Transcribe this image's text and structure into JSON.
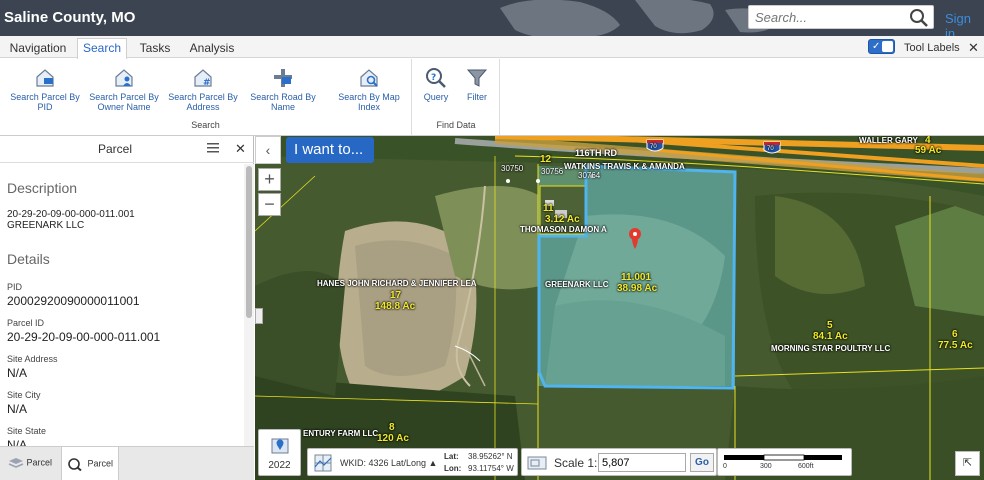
{
  "header": {
    "title": "Saline County, MO",
    "search_placeholder": "Search...",
    "sign_in": "Sign in"
  },
  "tabs": [
    {
      "label": "Navigation"
    },
    {
      "label": "Search"
    },
    {
      "label": "Tasks"
    },
    {
      "label": "Analysis"
    }
  ],
  "tool_labels": {
    "label": "Tool Labels",
    "enabled": true
  },
  "ribbon": {
    "search_group": {
      "label": "Search",
      "buttons": [
        {
          "label_line1": "Search Parcel By",
          "label_line2": "PID",
          "icon": "search-parcel-pid-icon"
        },
        {
          "label_line1": "Search Parcel By",
          "label_line2": "Owner Name",
          "icon": "search-parcel-owner-icon"
        },
        {
          "label_line1": "Search Parcel By",
          "label_line2": "Address",
          "icon": "search-parcel-address-icon"
        },
        {
          "label_line1": "Search Road By",
          "label_line2": "Name",
          "icon": "search-road-icon"
        },
        {
          "label_line1": "Search By Map",
          "label_line2": "Index",
          "icon": "search-map-index-icon"
        }
      ]
    },
    "find_group": {
      "label": "Find Data",
      "buttons": [
        {
          "label_line1": "Query",
          "icon": "query-icon"
        },
        {
          "label_line1": "Filter",
          "icon": "filter-icon"
        }
      ]
    }
  },
  "panel": {
    "title": "Parcel",
    "description_heading": "Description",
    "description_line1": "20-29-20-09-00-000-011.001",
    "description_line2": "GREENARK LLC",
    "details_heading": "Details",
    "fields": [
      {
        "label": "PID",
        "value": "20002920090000011001"
      },
      {
        "label": "Parcel ID",
        "value": "20-29-20-09-00-000-011.001"
      },
      {
        "label": "Site Address",
        "value": "N/A"
      },
      {
        "label": "Site City",
        "value": "N/A"
      },
      {
        "label": "Site State",
        "value": "N/A"
      }
    ],
    "bottom_tabs": [
      {
        "label": "Parcel",
        "icon": "layers-icon"
      },
      {
        "label": "Parcel",
        "icon": "search-results-icon"
      }
    ]
  },
  "map": {
    "i_want_to": "I want to...",
    "zoom_in": "+",
    "zoom_out": "−",
    "year": "2022",
    "wkid": "WKID: 4326 Lat/Long ▲",
    "lat_label": "Lat:",
    "lat_value": "38.95262° N",
    "lon_label": "Lon:",
    "lon_value": "93.11754° W",
    "scale_label": "Scale 1:",
    "scale_value": "5,807",
    "go": "Go",
    "scalebar_ticks": [
      "0",
      "300",
      "600ft"
    ],
    "labels": {
      "road_116th": "116TH RD",
      "i70_a": "70",
      "i70_b": "70",
      "waller": "WALLER GARY",
      "waller_num": "4",
      "waller_ac": "59 Ac",
      "watkins": "WATKINS TRAVIS K & AMANDA",
      "n12": "12",
      "n30750": "30750",
      "n30756": "30756",
      "n30764": "30764",
      "n11": "11",
      "ac_312": "3.12 Ac",
      "thomason": "THOMASON DAMON A",
      "hanes": "HANES JOHN RICHARD & JENNIFER LEA",
      "n17": "17",
      "ac_1488": "148.8 Ac",
      "greenark": "GREENARK LLC",
      "n11001": "11.001",
      "ac_3898": "38.98 Ac",
      "n5": "5",
      "ac_841": "84.1 Ac",
      "morningstar": "MORNING STAR POULTRY LLC",
      "n6": "6",
      "ac_775": "77.5 Ac",
      "century": "ENTURY FARM LLC",
      "n8": "8",
      "ac_120": "120 Ac"
    }
  },
  "colors": {
    "header_bg": "#3b4450",
    "accent": "#2868c5",
    "parcel_outline": "#4fb4ef",
    "parcel_line": "#e8e020",
    "highway": "#f0a020"
  }
}
